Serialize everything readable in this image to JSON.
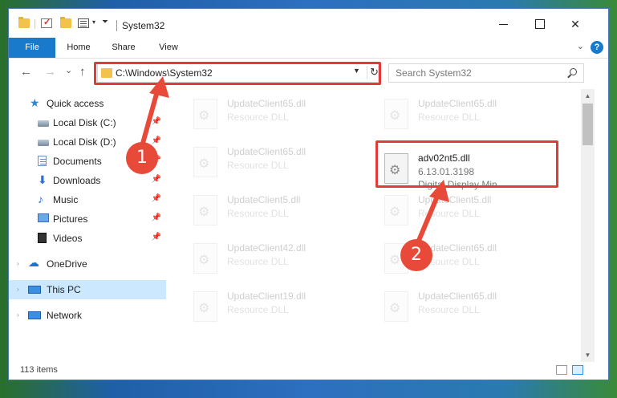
{
  "window": {
    "title": "System32"
  },
  "ribbon": {
    "tabs": [
      "File",
      "Home",
      "Share",
      "View"
    ],
    "help": "?"
  },
  "nav": {
    "back": "←",
    "forward": "→",
    "recent": "⌄",
    "up": "↑",
    "address": "C:\\Windows\\System32",
    "refresh": "↻",
    "search_placeholder": "Search System32"
  },
  "sidebar": {
    "items": [
      {
        "label": "Quick access",
        "icon": "star-icon",
        "pinned": false
      },
      {
        "label": "Local Disk (C:)",
        "icon": "drive-icon",
        "pinned": true
      },
      {
        "label": "Local Disk (D:)",
        "icon": "drive-icon",
        "pinned": true
      },
      {
        "label": "Documents",
        "icon": "documents-icon",
        "pinned": true
      },
      {
        "label": "Downloads",
        "icon": "downloads-icon",
        "pinned": true
      },
      {
        "label": "Music",
        "icon": "music-icon",
        "pinned": true
      },
      {
        "label": "Pictures",
        "icon": "pictures-icon",
        "pinned": true
      },
      {
        "label": "Videos",
        "icon": "videos-icon",
        "pinned": true
      },
      {
        "label": "OneDrive",
        "icon": "onedrive-icon",
        "pinned": false
      },
      {
        "label": "This PC",
        "icon": "pc-icon",
        "pinned": false,
        "selected": true
      },
      {
        "label": "Network",
        "icon": "network-icon",
        "pinned": false
      }
    ]
  },
  "files": {
    "left": [
      {
        "name": "UpdateClient65.dll",
        "type": "Resource DLL"
      },
      {
        "name": "UpdateClient65.dll",
        "type": "Resource DLL"
      },
      {
        "name": "UpdateClient5.dll",
        "type": "Resource DLL"
      },
      {
        "name": "UpdateClient42.dll",
        "type": "Resource DLL"
      },
      {
        "name": "UpdateClient19.dll",
        "type": "Resource DLL"
      }
    ],
    "right": [
      {
        "name": "UpdateClient65.dll",
        "type": "Resource DLL"
      },
      {
        "name": "adv02nt5.dll",
        "type": "6.13.01.3198",
        "desc": "Digital Display Min..."
      },
      {
        "name": "UpdateClient5.dll",
        "type": "Resource DLL"
      },
      {
        "name": "UpdateClient65.dll",
        "type": "Resource DLL"
      },
      {
        "name": "UpdateClient65.dll",
        "type": "Resource DLL"
      }
    ]
  },
  "status": {
    "count": "113 items"
  },
  "annotations": {
    "badge1": "1",
    "badge2": "2"
  },
  "colors": {
    "accent": "#1979ca",
    "highlight": "#e03a3a",
    "badge": "#e84a3a",
    "selected": "#cce8ff"
  }
}
